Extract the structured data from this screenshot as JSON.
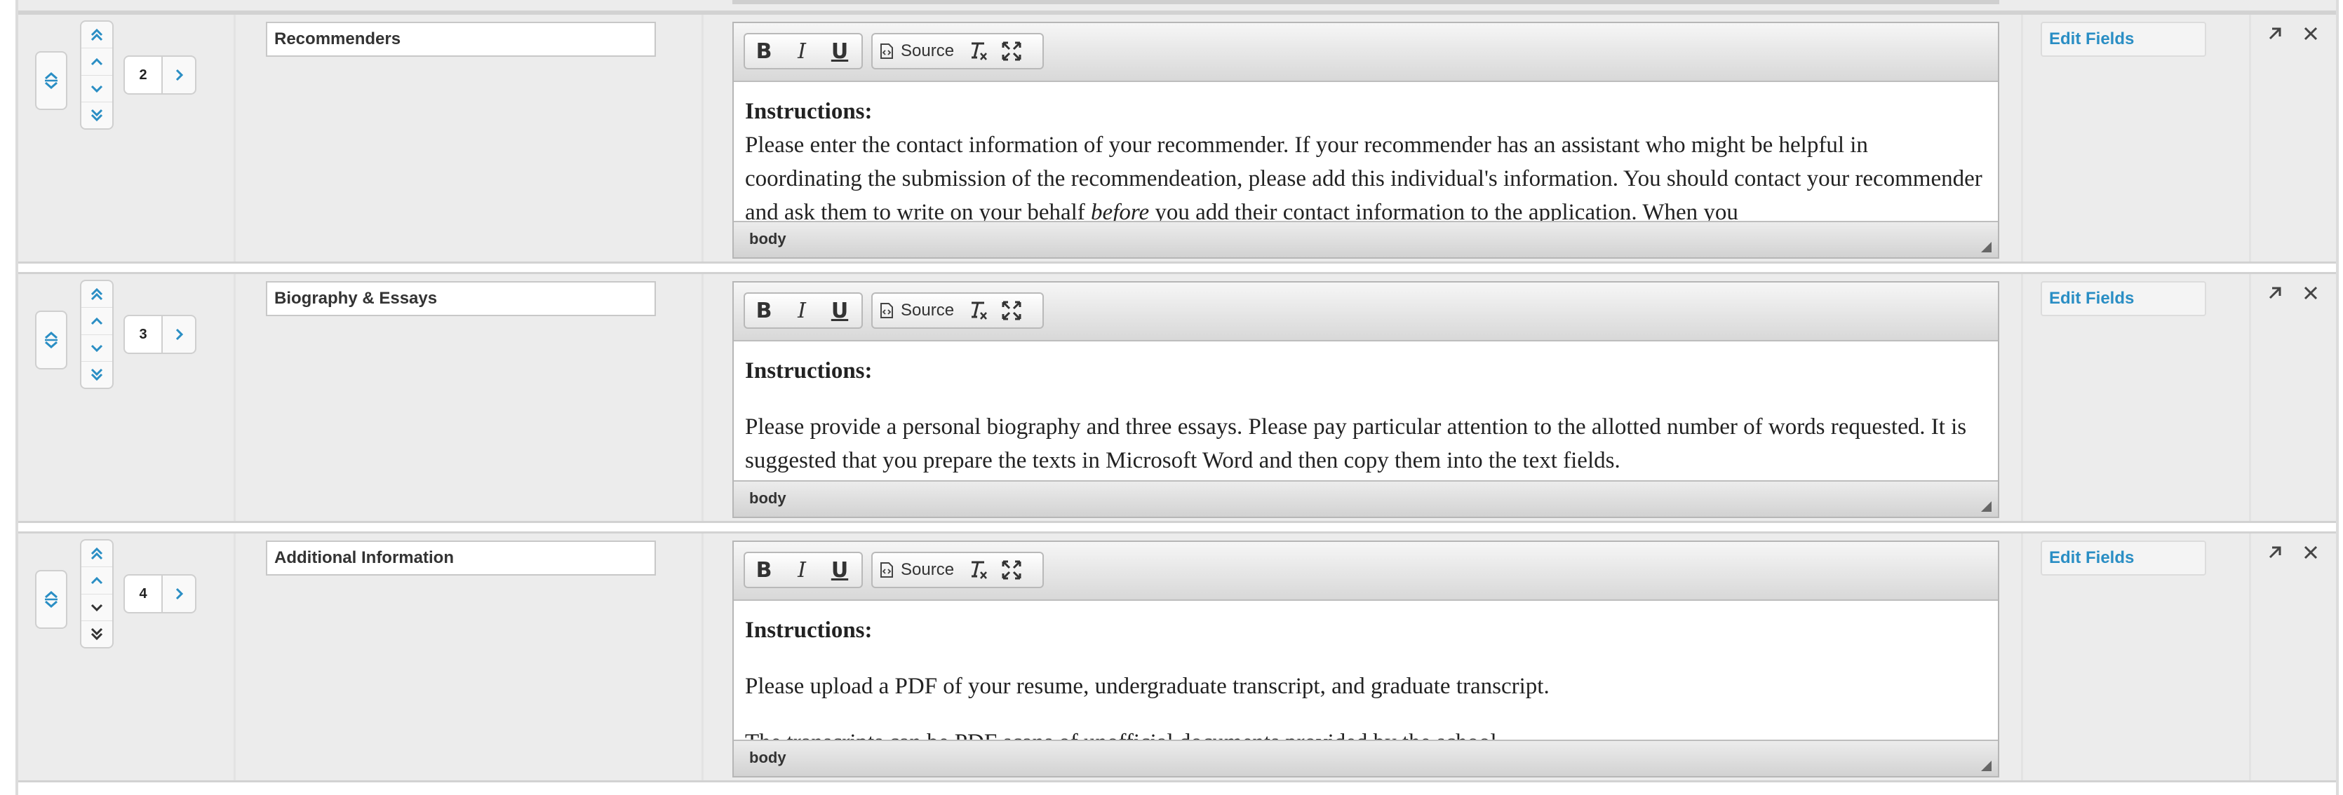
{
  "rows": [
    {
      "order": "2",
      "name": "Recommenders",
      "content": {
        "heading": "Instructions:",
        "p1_a": "Please enter the contact information of your recommender. If your recommender has an assistant who might be helpful in coordinating the submission of the recommendeation, please add this individual's information. You should contact your recommender and ask them to write on your behalf ",
        "p1_em": "before",
        "p1_b": " you add their contact information to the application. When you"
      },
      "status": "body",
      "edit_fields": "Edit Fields"
    },
    {
      "order": "3",
      "name": "Biography & Essays",
      "content": {
        "heading": "Instructions:",
        "p1": "Please provide a personal biography and three essays. Please pay particular  attention to the allotted number of words requested. It is suggested that you prepare the texts in Microsoft Word and then copy them into the text fields."
      },
      "status": "body",
      "edit_fields": "Edit Fields"
    },
    {
      "order": "4",
      "name": "Additional Information",
      "content": {
        "heading": "Instructions:",
        "p1": "Please upload a PDF of your resume, undergraduate transcript, and graduate transcript.",
        "p2": "The transcripts can be PDF scans of unofficial documents provided by the school."
      },
      "status": "body",
      "edit_fields": "Edit Fields"
    }
  ],
  "toolbar": {
    "bold_label": "B",
    "italic_label": "I",
    "underline_label": "U",
    "source_label": "Source"
  },
  "icons": {
    "move": "move-vertical-icon",
    "first": "chevron-double-up-icon",
    "up": "chevron-up-icon",
    "down": "chevron-down-icon",
    "last": "chevron-double-down-icon",
    "next": "chevron-right-icon",
    "expand": "external-link-icon",
    "remove": "close-icon"
  },
  "colors": {
    "accent": "#2a8ec4",
    "row_bg": "#ececec",
    "toolbar_top": "#f6f6f6",
    "toolbar_bottom": "#d8d8d8"
  }
}
